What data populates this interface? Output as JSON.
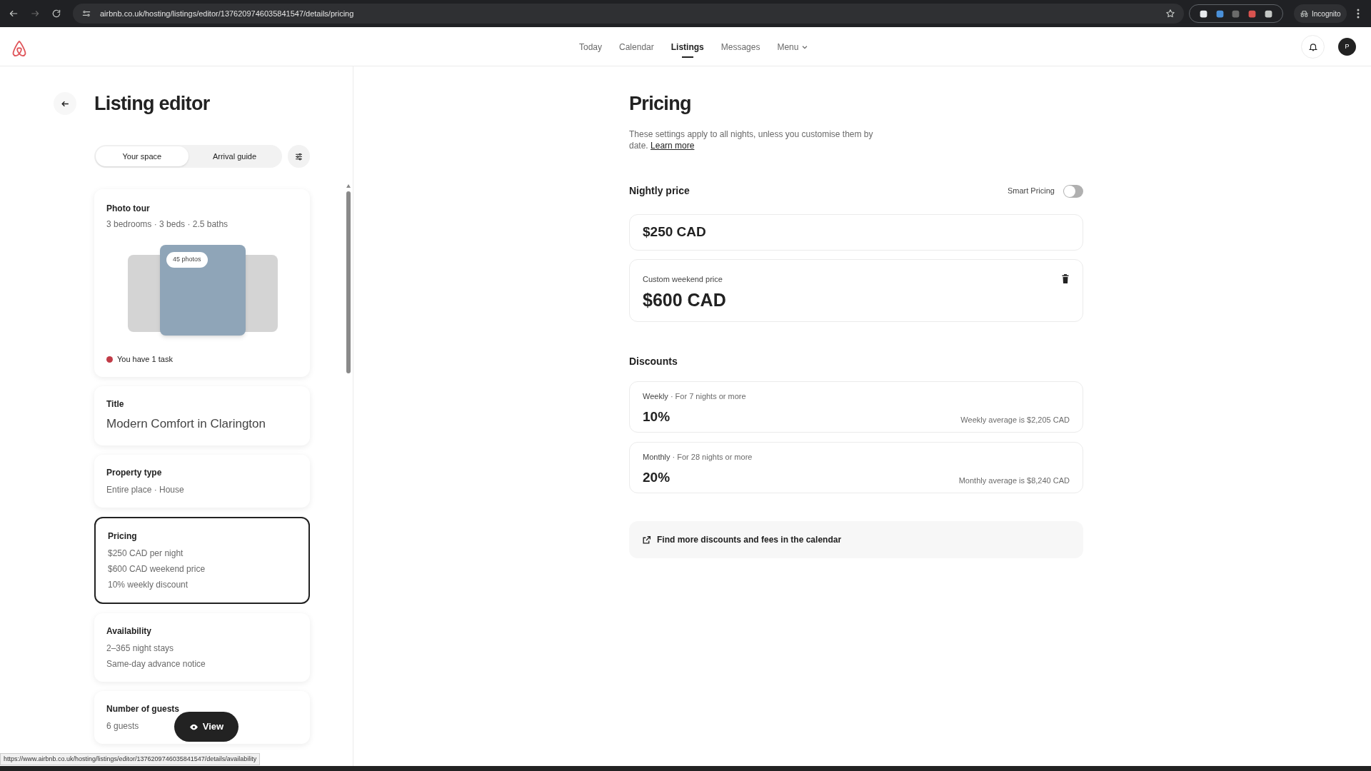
{
  "browser": {
    "url": "airbnb.co.uk/hosting/listings/editor/1376209746035841547/details/pricing",
    "profile_label": "Incognito"
  },
  "nav": {
    "items": [
      {
        "label": "Today",
        "selected": false
      },
      {
        "label": "Calendar",
        "selected": false
      },
      {
        "label": "Listings",
        "selected": true
      },
      {
        "label": "Messages",
        "selected": false
      }
    ],
    "menu_label": "Menu",
    "avatar_initial": "P"
  },
  "editor": {
    "title": "Listing editor",
    "tabs": [
      {
        "label": "Your space",
        "selected": true
      },
      {
        "label": "Arrival guide",
        "selected": false
      }
    ],
    "cards": [
      {
        "kind": "photos",
        "title": "Photo tour",
        "subtitle": "3 bedrooms · 3 beds · 2.5 baths",
        "photo_count": "45 photos",
        "task": "You have 1 task",
        "color": "#c13b47",
        "selected": false
      },
      {
        "kind": "title",
        "title": "Title",
        "value": "Modern Comfort in Clarington",
        "selected": false
      },
      {
        "kind": "lines",
        "title": "Property type",
        "lines": [
          "Entire place · House"
        ],
        "selected": false
      },
      {
        "kind": "lines",
        "title": "Pricing",
        "lines": [
          "$250 CAD per night",
          "$600 CAD weekend price",
          "10% weekly discount"
        ],
        "selected": true
      },
      {
        "kind": "lines",
        "title": "Availability",
        "lines": [
          "2–365 night stays",
          "Same-day advance notice"
        ],
        "selected": false
      },
      {
        "kind": "lines",
        "title": "Number of guests",
        "lines": [
          "6 guests"
        ],
        "selected": false
      }
    ],
    "view_button": "View"
  },
  "pricing": {
    "title": "Pricing",
    "description": "These settings apply to all nights, unless you customise them by date.",
    "learn_more": "Learn more",
    "nightly_heading": "Nightly price",
    "smart_pricing": {
      "label": "Smart Pricing",
      "on": false
    },
    "base_price": "$250 CAD",
    "weekend": {
      "label": "Custom weekend price",
      "value": "$600 CAD"
    },
    "discounts_heading": "Discounts",
    "discounts": [
      {
        "name": "Weekly",
        "condition": "· For 7 nights or more",
        "value": "10%",
        "average": "Weekly average is $2,205 CAD"
      },
      {
        "name": "Monthly",
        "condition": "· For 28 nights or more",
        "value": "20%",
        "average": "Monthly average is $8,240 CAD"
      }
    ],
    "calendar_link": "Find more discounts and fees in the calendar"
  },
  "status_url": "https://www.airbnb.co.uk/hosting/listings/editor/1376209746035841547/details/availability"
}
